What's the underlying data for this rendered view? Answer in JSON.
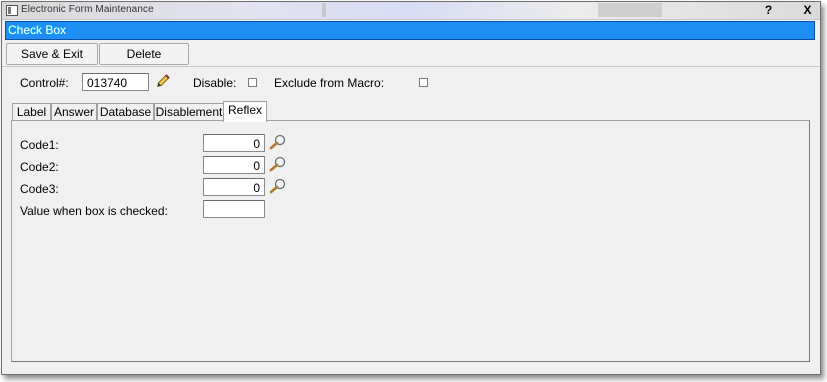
{
  "window": {
    "title": "Electronic Form Maintenance",
    "help_label": "?",
    "close_label": "X"
  },
  "form_bar": {
    "label": "Check Box"
  },
  "toolbar": {
    "save_exit_label": "Save & Exit",
    "delete_label": "Delete"
  },
  "control": {
    "label": "Control#:",
    "value": "013740",
    "disable_label": "Disable:",
    "disable_checked": false,
    "exclude_label": "Exclude from Macro:",
    "exclude_checked": false
  },
  "tabs": [
    {
      "label": "Label"
    },
    {
      "label": "Answer"
    },
    {
      "label": "Database"
    },
    {
      "label": "Disablement"
    },
    {
      "label": "Reflex"
    }
  ],
  "reflex": {
    "code1_label": "Code1:",
    "code1_value": "0",
    "code2_label": "Code2:",
    "code2_value": "0",
    "code3_label": "Code3:",
    "code3_value": "0",
    "checked_value_label": "Value when box is checked:",
    "checked_value": ""
  }
}
